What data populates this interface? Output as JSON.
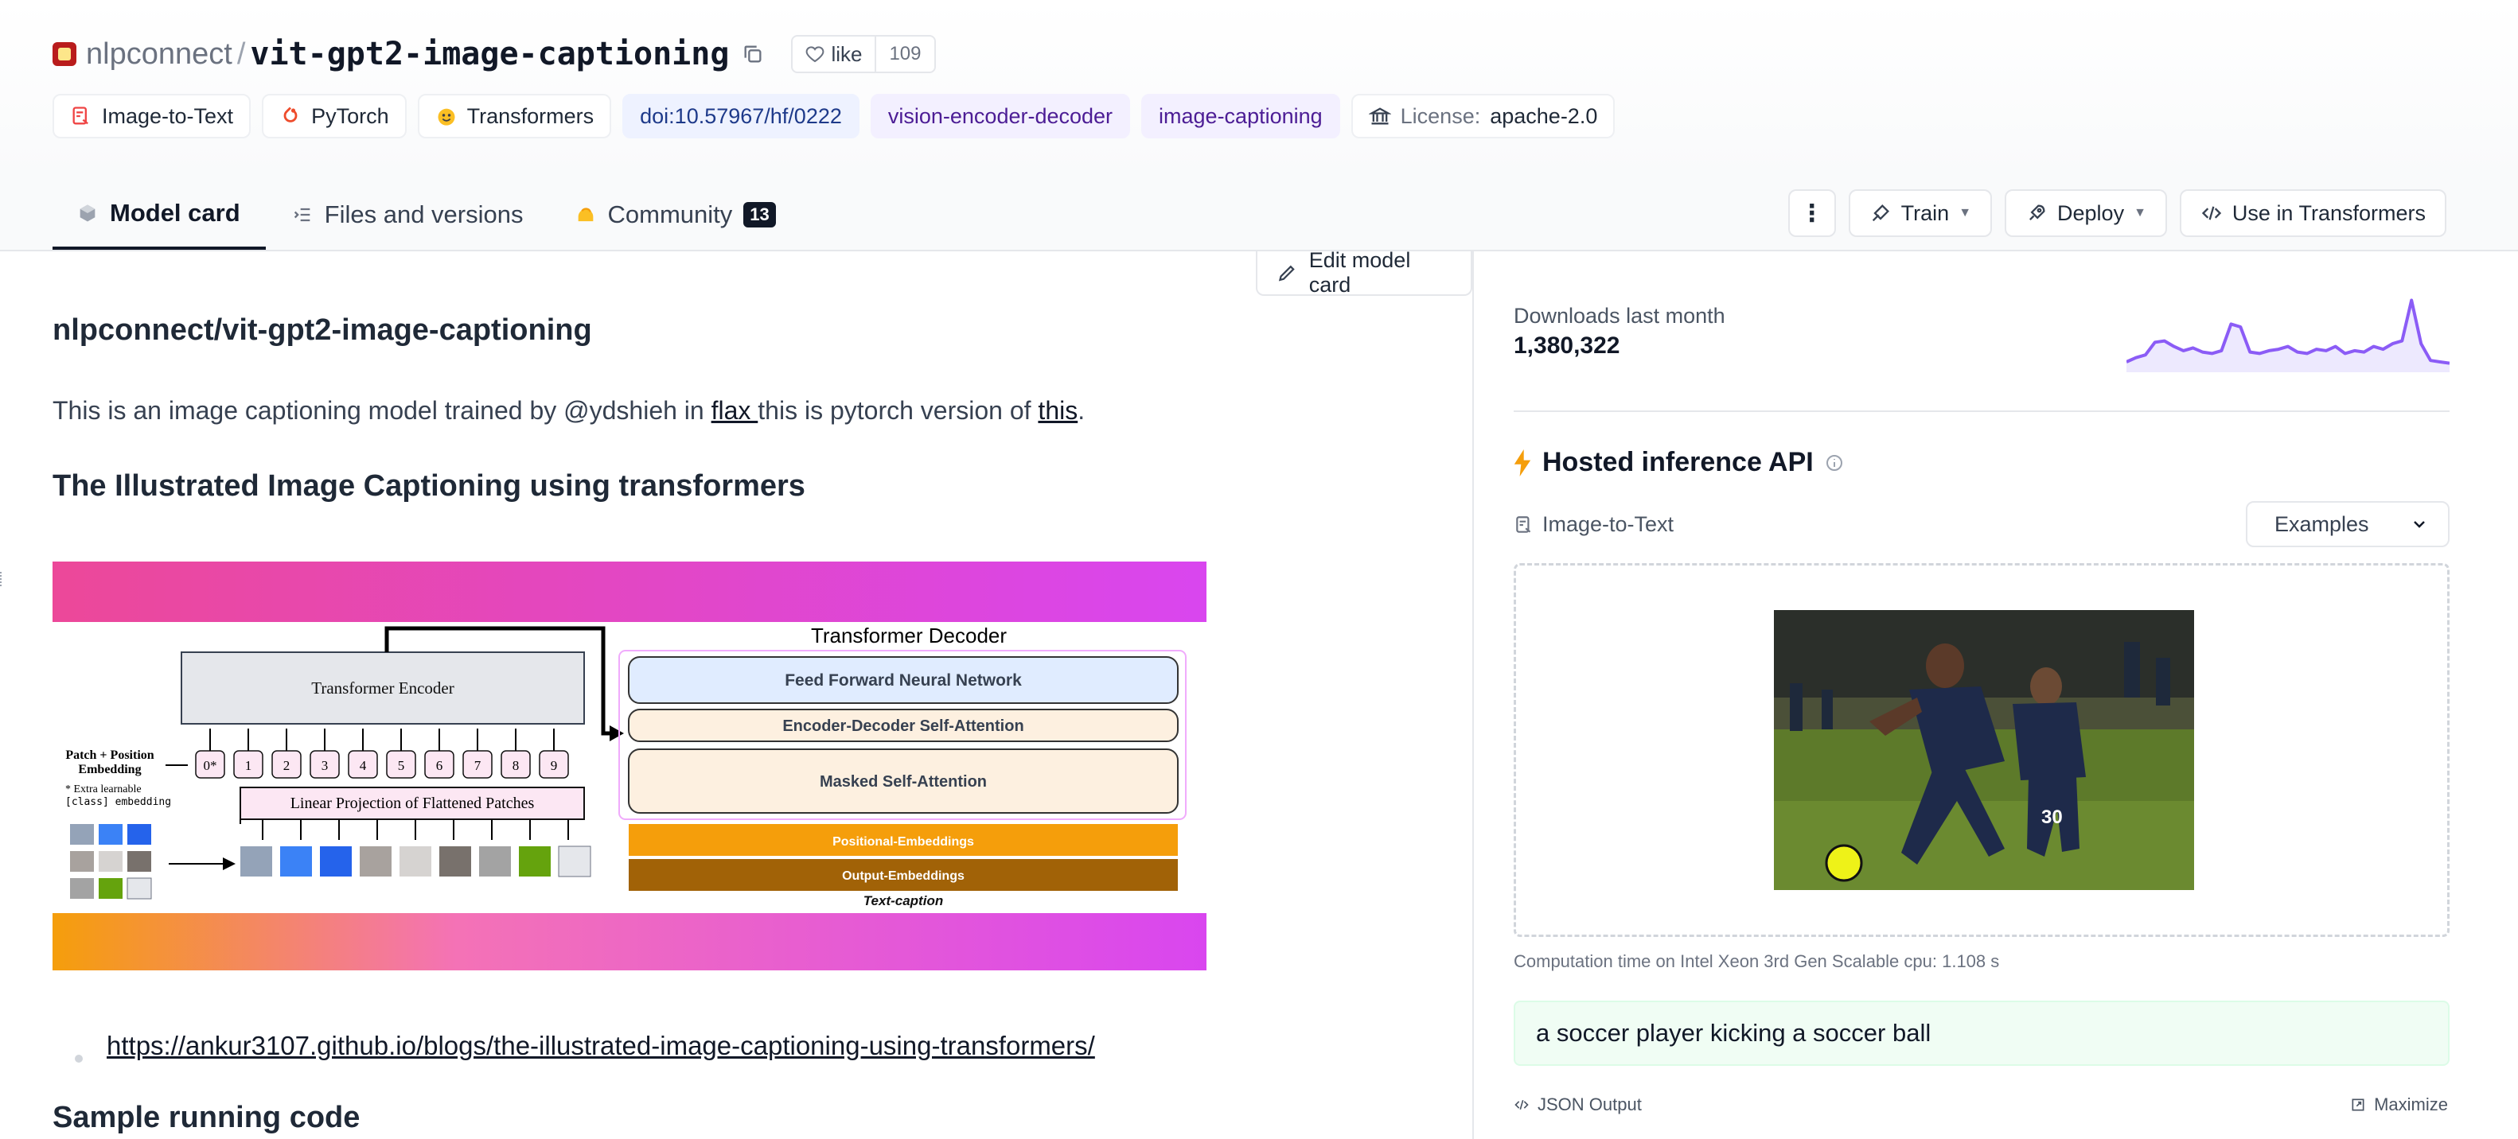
{
  "header": {
    "org": "nlpconnect",
    "separator": "/",
    "repo": "vit-gpt2-image-captioning",
    "like_label": "like",
    "like_count": "109"
  },
  "tags": [
    {
      "label": "Image-to-Text",
      "icon": "image-to-text-icon"
    },
    {
      "label": "PyTorch",
      "icon": "pytorch-icon"
    },
    {
      "label": "Transformers",
      "icon": "transformers-icon"
    },
    {
      "label": "doi:10.57967/hf/0222"
    },
    {
      "label": "vision-encoder-decoder"
    },
    {
      "label": "image-captioning"
    },
    {
      "label_prefix": "License:",
      "label": "apache-2.0",
      "icon": "bank-icon"
    }
  ],
  "tabs": [
    {
      "label": "Model card"
    },
    {
      "label": "Files and versions"
    },
    {
      "label": "Community",
      "badge": "13"
    }
  ],
  "actions": {
    "more": "⋮",
    "train": "Train",
    "deploy": "Deploy",
    "use": "Use in Transformers"
  },
  "content": {
    "edit_label": "Edit model card",
    "model_heading": "nlpconnect/vit-gpt2-image-captioning",
    "para_before": "This is an image captioning model trained by @ydshieh in ",
    "link_flax": "flax ",
    "para_middle": "this is pytorch version of ",
    "link_this": "this",
    "para_end": ".",
    "heading_illustrated": "The Illustrated Image Captioning using transformers",
    "blog_link": "https://ankur3107.github.io/blogs/the-illustrated-image-captioning-using-transformers/",
    "heading_sample": "Sample running code"
  },
  "diagram": {
    "decoder_title": "Transformer Decoder",
    "encoder": "Transformer Encoder",
    "ffn": "Feed Forward Neural Network",
    "cross_attn": "Encoder-Decoder Self-Attention",
    "masked_attn": "Masked Self-Attention",
    "pos_emb": "Positional-Embeddings",
    "out_emb": "Output-Embeddings",
    "text_caption": "Text-caption",
    "patch_label_1": "Patch + Position",
    "patch_label_2": "Embedding",
    "extra_1": "* Extra learnable",
    "extra_2": "[class] embedding",
    "projection": "Linear Projection of Flattened Patches",
    "token_labels": [
      "0*",
      "1",
      "2",
      "3",
      "4",
      "5",
      "6",
      "7",
      "8",
      "9"
    ]
  },
  "sidebar": {
    "downloads_label": "Downloads last month",
    "downloads_count": "1,380,322",
    "downloads_trend": [
      0.08,
      0.14,
      0.18,
      0.36,
      0.38,
      0.3,
      0.24,
      0.28,
      0.22,
      0.2,
      0.24,
      0.62,
      0.58,
      0.22,
      0.2,
      0.24,
      0.26,
      0.3,
      0.22,
      0.2,
      0.26,
      0.24,
      0.3,
      0.2,
      0.24,
      0.22,
      0.3,
      0.26,
      0.34,
      0.38,
      0.96,
      0.34,
      0.1,
      0.08,
      0.06
    ],
    "hosted_title": "Hosted inference API",
    "task": "Image-to-Text",
    "examples": "Examples",
    "computation": "Computation time on Intel Xeon 3rd Gen Scalable cpu: 1.108 s",
    "output": "a soccer player kicking a soccer ball",
    "json_output": "JSON Output",
    "maximize": "Maximize"
  },
  "colors": {
    "accent_purple": "#8b5cf6",
    "tag_blue_bg": "#eef2ff",
    "tag_purple_bg": "#f3f0ff",
    "output_bg": "#f0fdf4",
    "lightning": "#f59e0b"
  }
}
